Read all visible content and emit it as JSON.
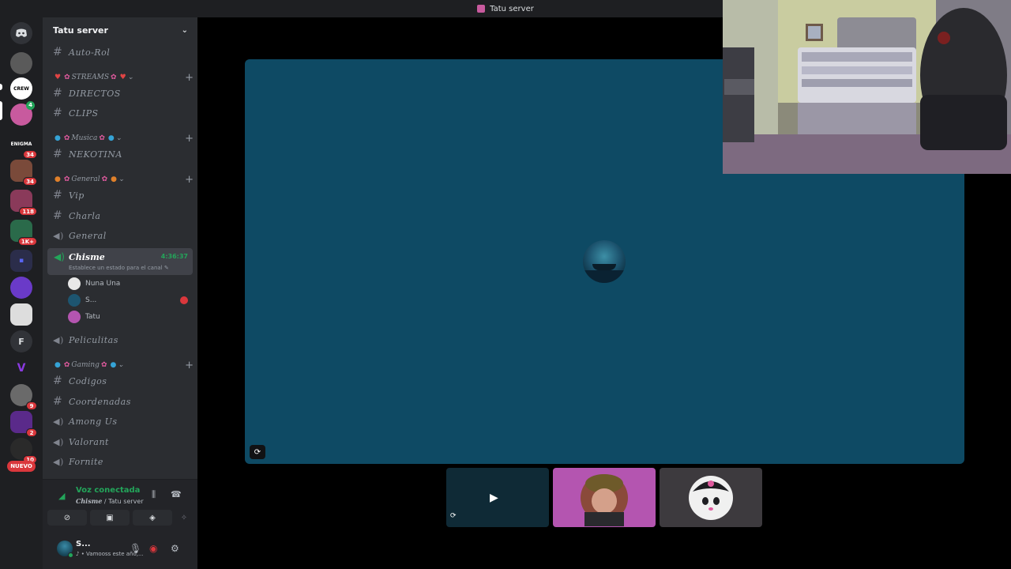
{
  "window": {
    "title": "Tatu server"
  },
  "rail": {
    "servers": [
      {
        "name": "home-icon",
        "badge": ""
      },
      {
        "name": "server-1",
        "badge": ""
      },
      {
        "name": "server-gaming-crew",
        "badge": ""
      },
      {
        "name": "server-tatu",
        "badge": "4"
      },
      {
        "name": "server-enigma",
        "label": "ENIGMA",
        "badge": "34"
      },
      {
        "name": "server-group",
        "badge": "34"
      },
      {
        "name": "server-group-2",
        "badge": "118"
      },
      {
        "name": "server-group-3",
        "badge": "1K+"
      },
      {
        "name": "folder",
        "badge": ""
      },
      {
        "name": "server-purple",
        "badge": ""
      },
      {
        "name": "server-gray",
        "badge": ""
      },
      {
        "name": "server-f",
        "label": "F",
        "badge": ""
      },
      {
        "name": "server-v",
        "label": "V",
        "badge": ""
      },
      {
        "name": "server-photo",
        "badge": "9"
      },
      {
        "name": "server-game",
        "badge": "2"
      },
      {
        "name": "server-dark",
        "badge": "10"
      }
    ],
    "new_label": "NUEVO"
  },
  "sidebar": {
    "server_name": "Tatu server",
    "channels": {
      "auto_rol": "Auto-Rol",
      "cat_streams": "STREAMS",
      "directos": "DIRECTOS",
      "clips": "CLIPS",
      "cat_musica": "Musica",
      "nekotina": "NEKOTINA",
      "cat_general": "General",
      "vip": "Vip",
      "charla": "Charla",
      "general": "General",
      "chisme": "Chisme",
      "chisme_timer": "4:36:37",
      "chisme_status": "Establece un estado para el canal",
      "peliculitas": "Peliculitas",
      "cat_gaming": "Gaming",
      "codigos": "Codigos",
      "coordenadas": "Coordenadas",
      "among_us": "Among Us",
      "valorant": "Valorant",
      "fornite": "Fornite"
    },
    "members": [
      "Nuna Una",
      "S...",
      "Tatu"
    ]
  },
  "voice_panel": {
    "title": "Voz conectada",
    "channel": "Chisme",
    "server": "Tatu server"
  },
  "user_panel": {
    "name": "S...",
    "status": "• Vamooss este año,..."
  },
  "colors": {
    "accent_green": "#23a55a",
    "live_red": "#da373c",
    "stage_bg": "#0e4a64",
    "tile_pink": "#b455b0"
  }
}
